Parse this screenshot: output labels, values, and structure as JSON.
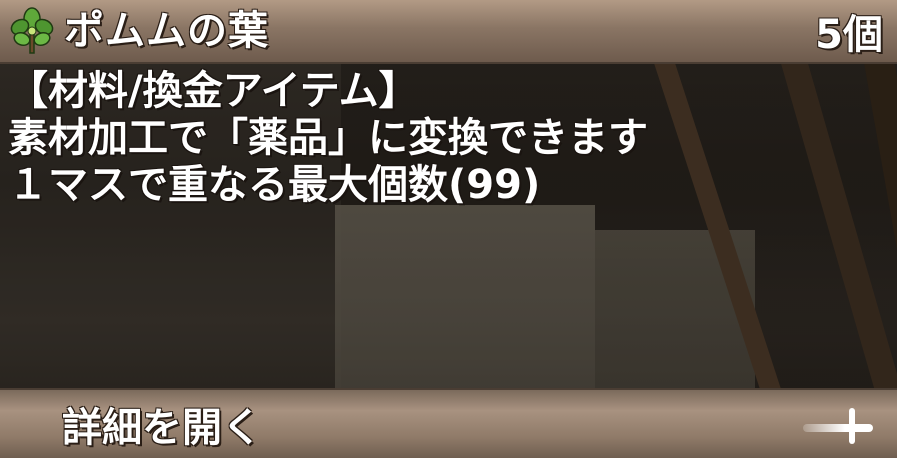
{
  "item": {
    "name": "ポムムの葉",
    "count": "5個",
    "icon": "leaf-icon"
  },
  "description": {
    "lines": [
      "【材料/換金アイテム】",
      "素材加工で「薬品」に変換できます",
      "１マスで重なる最大個数(99)"
    ]
  },
  "footer": {
    "details_label": "詳細を開く",
    "expand_icon": "plus-icon"
  },
  "colors": {
    "header_band": "#8a7564",
    "footer_band": "#a89280",
    "text": "#ffffff"
  }
}
